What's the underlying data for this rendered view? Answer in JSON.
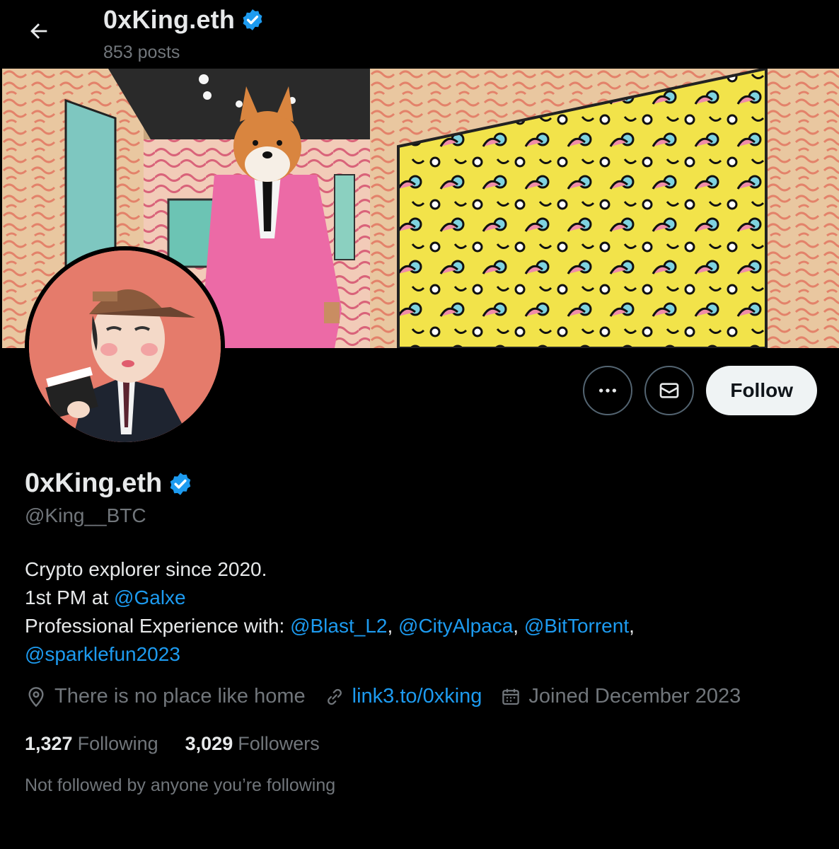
{
  "header": {
    "title": "0xKing.eth",
    "posts": "853 posts"
  },
  "actions": {
    "follow_label": "Follow"
  },
  "profile": {
    "name": "0xKing.eth",
    "handle": "@King__BTC",
    "bio": {
      "line1": "Crypto explorer since 2020.",
      "line2_prefix": "1st PM at ",
      "line2_mention": "@Galxe",
      "line3_prefix": "Professional Experience with: ",
      "mentions": [
        "@Blast_L2",
        "@CityAlpaca",
        "@BitTorrent",
        "@sparklefun2023"
      ],
      "separator": ", "
    },
    "location": "There is no place like home",
    "website": "link3.to/0xking",
    "joined": "Joined December 2023",
    "following_count": "1,327",
    "following_label": "Following",
    "followers_count": "3,029",
    "followers_label": "Followers",
    "not_followed_text": "Not followed by anyone you’re following"
  },
  "icons": {
    "back": "arrow-left-icon",
    "verified": "verified-badge-icon",
    "more": "more-icon",
    "message": "envelope-icon",
    "location": "location-pin-icon",
    "link": "link-icon",
    "calendar": "calendar-icon"
  },
  "colors": {
    "background": "#000000",
    "accent": "#1d9bf0",
    "text": "#e7e9ea",
    "muted": "#71767b",
    "follow_bg": "#eff3f4"
  }
}
